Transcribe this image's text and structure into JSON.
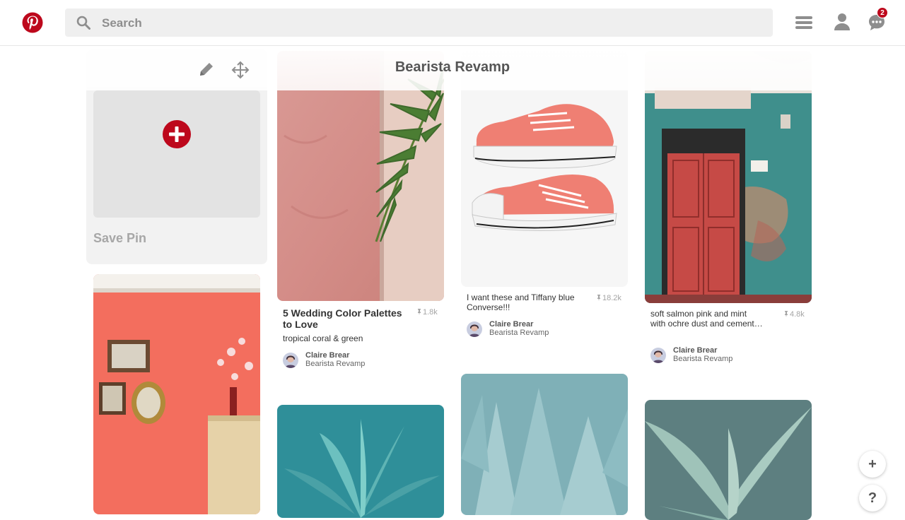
{
  "header": {
    "search_placeholder": "Search",
    "notification_count": "2",
    "icons": [
      "pinterest-logo-icon",
      "search-icon",
      "menu-icon",
      "profile-icon",
      "messages-icon"
    ],
    "brand_color": "#bd081c"
  },
  "board": {
    "title": "Bearista Revamp",
    "edit_icon": "pencil-icon",
    "move_icon": "move-arrows-icon"
  },
  "save_card": {
    "label": "Save Pin"
  },
  "pins": [
    {
      "title": "5 Wedding Color Palettes to Love",
      "description": "tropical coral & green",
      "saves": "1.8k",
      "user": "Claire Brear",
      "board": "Bearista Revamp"
    },
    {
      "description": "I want these and Tiffany blue Converse!!!",
      "saves": "18.2k",
      "user": "Claire Brear",
      "board": "Bearista Revamp"
    },
    {
      "description": "soft salmon pink and mint with ochre dust and cement…",
      "saves": "4.8k",
      "user": "Claire Brear",
      "board": "Bearista Revamp"
    }
  ],
  "fab": {
    "add_label": "+",
    "help_label": "?"
  }
}
